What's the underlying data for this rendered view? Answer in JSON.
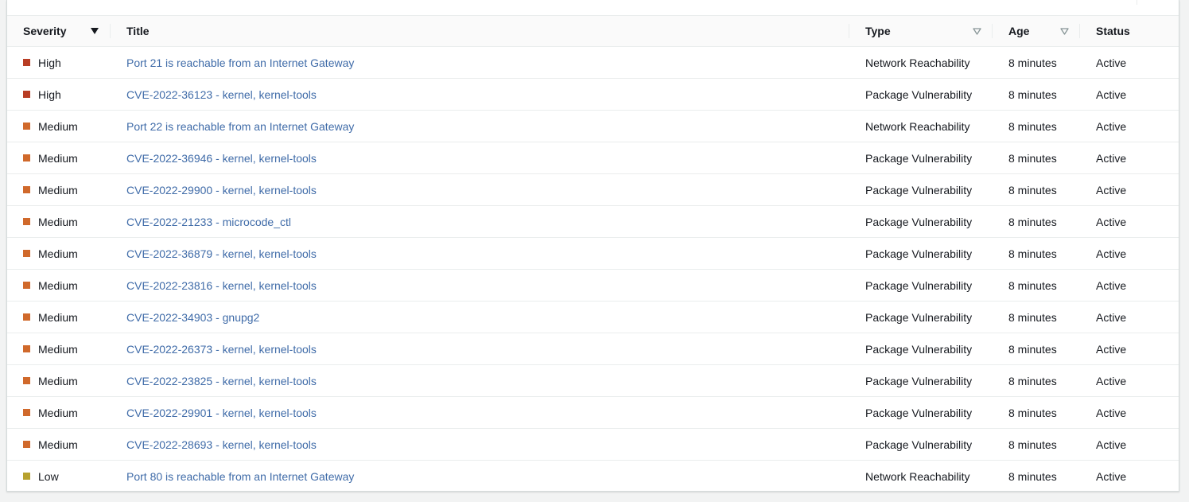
{
  "colors": {
    "high": "#b83d24",
    "medium": "#d0692b",
    "low": "#b7a12e",
    "link": "#3f6ba8"
  },
  "columns": [
    {
      "key": "severity",
      "label": "Severity",
      "sort": "active-desc"
    },
    {
      "key": "title",
      "label": "Title",
      "sort": "none"
    },
    {
      "key": "type",
      "label": "Type",
      "sort": "idle"
    },
    {
      "key": "age",
      "label": "Age",
      "sort": "idle"
    },
    {
      "key": "status",
      "label": "Status",
      "sort": "none"
    }
  ],
  "rows": [
    {
      "severity": "High",
      "level": "high",
      "title": "Port 21 is reachable from an Internet Gateway",
      "type": "Network Reachability",
      "age": "8 minutes",
      "status": "Active"
    },
    {
      "severity": "High",
      "level": "high",
      "title": "CVE-2022-36123 - kernel, kernel-tools",
      "type": "Package Vulnerability",
      "age": "8 minutes",
      "status": "Active"
    },
    {
      "severity": "Medium",
      "level": "medium",
      "title": "Port 22 is reachable from an Internet Gateway",
      "type": "Network Reachability",
      "age": "8 minutes",
      "status": "Active"
    },
    {
      "severity": "Medium",
      "level": "medium",
      "title": "CVE-2022-36946 - kernel, kernel-tools",
      "type": "Package Vulnerability",
      "age": "8 minutes",
      "status": "Active"
    },
    {
      "severity": "Medium",
      "level": "medium",
      "title": "CVE-2022-29900 - kernel, kernel-tools",
      "type": "Package Vulnerability",
      "age": "8 minutes",
      "status": "Active"
    },
    {
      "severity": "Medium",
      "level": "medium",
      "title": "CVE-2022-21233 - microcode_ctl",
      "type": "Package Vulnerability",
      "age": "8 minutes",
      "status": "Active"
    },
    {
      "severity": "Medium",
      "level": "medium",
      "title": "CVE-2022-36879 - kernel, kernel-tools",
      "type": "Package Vulnerability",
      "age": "8 minutes",
      "status": "Active"
    },
    {
      "severity": "Medium",
      "level": "medium",
      "title": "CVE-2022-23816 - kernel, kernel-tools",
      "type": "Package Vulnerability",
      "age": "8 minutes",
      "status": "Active"
    },
    {
      "severity": "Medium",
      "level": "medium",
      "title": "CVE-2022-34903 - gnupg2",
      "type": "Package Vulnerability",
      "age": "8 minutes",
      "status": "Active"
    },
    {
      "severity": "Medium",
      "level": "medium",
      "title": "CVE-2022-26373 - kernel, kernel-tools",
      "type": "Package Vulnerability",
      "age": "8 minutes",
      "status": "Active"
    },
    {
      "severity": "Medium",
      "level": "medium",
      "title": "CVE-2022-23825 - kernel, kernel-tools",
      "type": "Package Vulnerability",
      "age": "8 minutes",
      "status": "Active"
    },
    {
      "severity": "Medium",
      "level": "medium",
      "title": "CVE-2022-29901 - kernel, kernel-tools",
      "type": "Package Vulnerability",
      "age": "8 minutes",
      "status": "Active"
    },
    {
      "severity": "Medium",
      "level": "medium",
      "title": "CVE-2022-28693 - kernel, kernel-tools",
      "type": "Package Vulnerability",
      "age": "8 minutes",
      "status": "Active"
    },
    {
      "severity": "Low",
      "level": "low",
      "title": "Port 80 is reachable from an Internet Gateway",
      "type": "Network Reachability",
      "age": "8 minutes",
      "status": "Active"
    }
  ]
}
